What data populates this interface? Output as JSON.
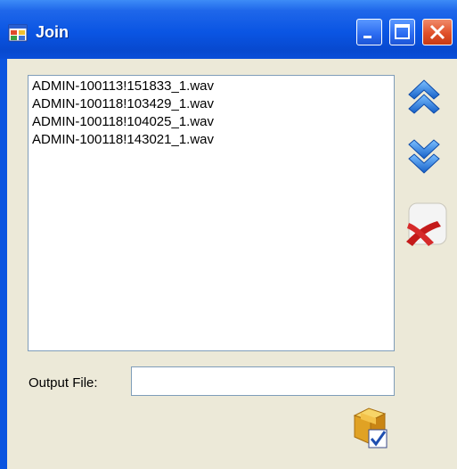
{
  "window": {
    "title": "Join"
  },
  "files": [
    "ADMIN-100113!151833_1.wav",
    "ADMIN-100118!103429_1.wav",
    "ADMIN-100118!104025_1.wav",
    "ADMIN-100118!143021_1.wav"
  ],
  "output": {
    "label": "Output File:",
    "value": ""
  },
  "icons": {
    "move_up": "double-chevron-up-icon",
    "move_down": "double-chevron-down-icon",
    "remove": "red-x-icon",
    "join": "box-checkmark-icon"
  },
  "colors": {
    "titlebar": "#0a55e3",
    "client": "#ece9d8",
    "close": "#e0502a",
    "chevron": "#1f6fd6"
  }
}
